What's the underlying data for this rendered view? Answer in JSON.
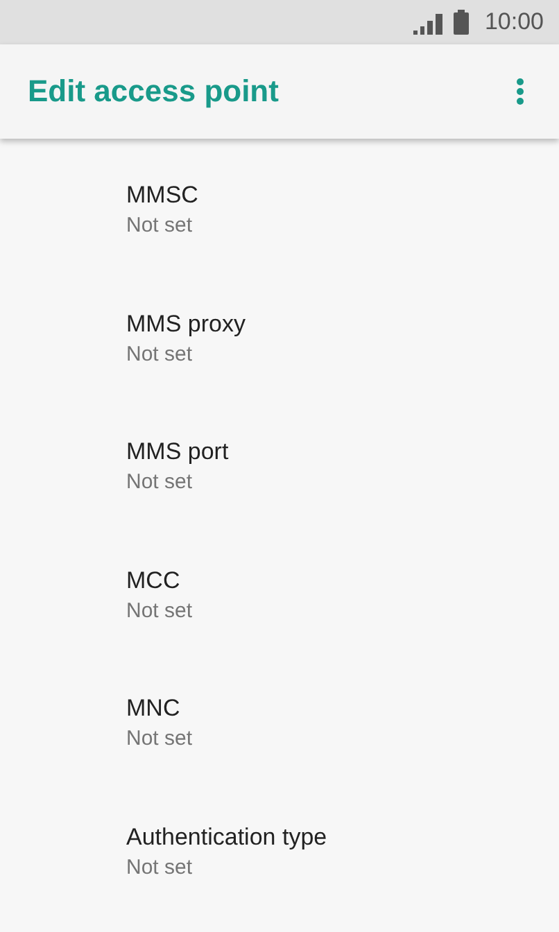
{
  "status_bar": {
    "time": "10:00"
  },
  "app_bar": {
    "title": "Edit access point"
  },
  "settings": [
    {
      "title": "MMSC",
      "summary": "Not set"
    },
    {
      "title": "MMS proxy",
      "summary": "Not set"
    },
    {
      "title": "MMS port",
      "summary": "Not set"
    },
    {
      "title": "MCC",
      "summary": "Not set"
    },
    {
      "title": "MNC",
      "summary": "Not set"
    },
    {
      "title": "Authentication type",
      "summary": "Not set"
    }
  ]
}
